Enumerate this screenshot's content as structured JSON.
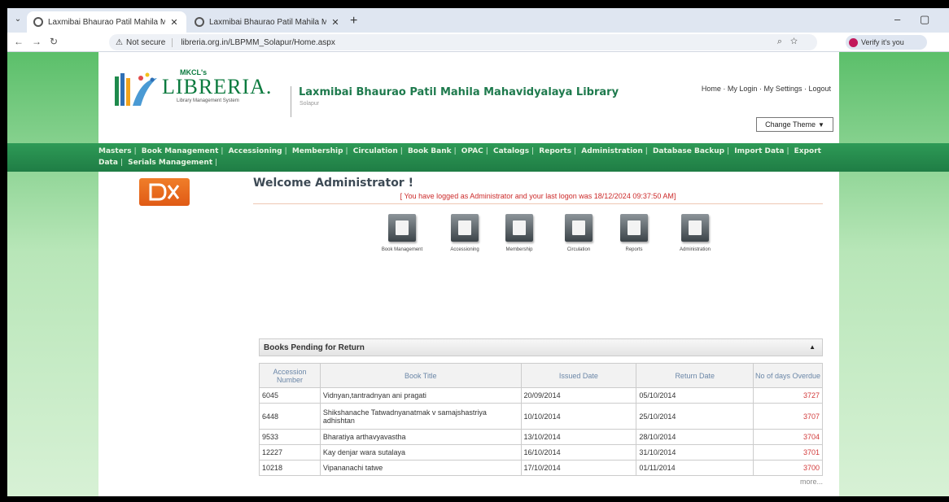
{
  "browser": {
    "tabs": [
      {
        "title": "Laxmibai Bhaurao Patil Mahila Mahavidyalaya",
        "active": true
      },
      {
        "title": "Laxmibai Bhaurao Patil Mahila Mahavidyalaya",
        "active": false
      }
    ],
    "not_secure_label": "Not secure",
    "url": "libreria.org.in/LBPMM_Solapur/Home.aspx",
    "profile_label": "Verify it's you"
  },
  "header": {
    "logo_brand": "MKCL's",
    "logo_name": "LIBRERIA.",
    "logo_tagline": "Library Management System",
    "library_name": "Laxmibai Bhaurao Patil Mahila Mahavidyalaya Library",
    "library_city": "Solapur",
    "top_links": [
      "Home",
      "My Login",
      "My Settings",
      "Logout"
    ],
    "change_theme_label": "Change Theme"
  },
  "menu": {
    "items": [
      "Masters",
      "Book Management",
      "Accessioning",
      "Membership",
      "Circulation",
      "Book Bank",
      "OPAC",
      "Catalogs",
      "Reports",
      "Administration",
      "Database Backup",
      "Import Data",
      "Export Data",
      "Serials Management"
    ]
  },
  "welcome": {
    "title": "Welcome Administrator !",
    "last_login": "[ You have logged as Administrator and your last logon was 18/12/2024 09:37:50 AM]"
  },
  "quick_icons": [
    {
      "label": "Book Management",
      "icon": "book-management-icon"
    },
    {
      "label": "Accessioning",
      "icon": "accessioning-icon"
    },
    {
      "label": "Membership",
      "icon": "membership-icon"
    },
    {
      "label": "Circulation",
      "icon": "circulation-icon"
    },
    {
      "label": "Reports",
      "icon": "reports-icon"
    },
    {
      "label": "Administration",
      "icon": "administration-icon"
    }
  ],
  "pending": {
    "title": "Books Pending for Return",
    "columns": [
      "Accession Number",
      "Book Title",
      "Issued Date",
      "Return Date",
      "No of days Overdue"
    ],
    "rows": [
      {
        "accession": "6045",
        "title": "Vidnyan,tantradnyan ani pragati",
        "issued": "20/09/2014",
        "return": "05/10/2014",
        "days": "3727"
      },
      {
        "accession": "6448",
        "title": "Shikshanache Tatwadnyanatmak v samajshastriya adhishtan",
        "issued": "10/10/2014",
        "return": "25/10/2014",
        "days": "3707"
      },
      {
        "accession": "9533",
        "title": "Bharatiya arthavyavastha",
        "issued": "13/10/2014",
        "return": "28/10/2014",
        "days": "3704"
      },
      {
        "accession": "12227",
        "title": "Kay denjar wara sutalaya",
        "issued": "16/10/2014",
        "return": "31/10/2014",
        "days": "3701"
      },
      {
        "accession": "10218",
        "title": "Vipananachi tatwe",
        "issued": "17/10/2014",
        "return": "01/11/2014",
        "days": "3700"
      }
    ],
    "more_label": "more..."
  }
}
